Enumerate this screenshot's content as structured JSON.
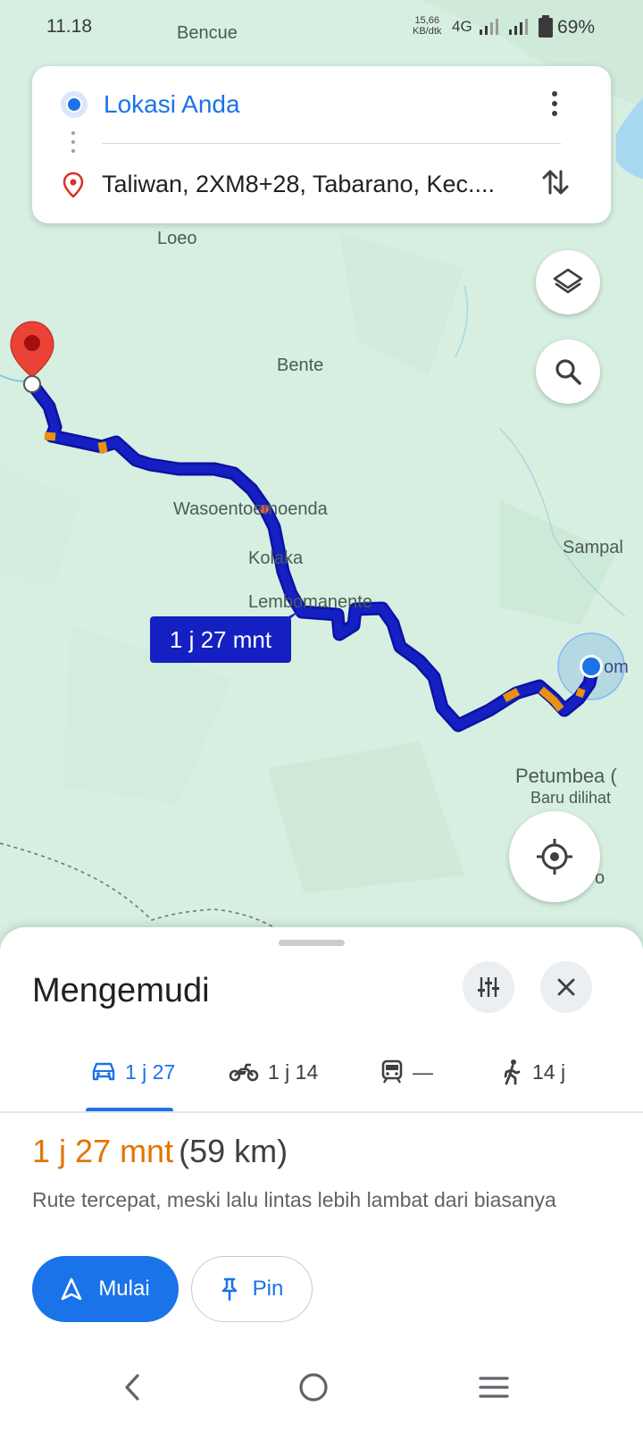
{
  "status_bar": {
    "time": "11.18",
    "speed_value": "15,66",
    "speed_unit": "KB/dtk",
    "network": "4G",
    "battery": "69%"
  },
  "map": {
    "labels": {
      "bencue": "Bencue",
      "loeo": "Loeo",
      "bente": "Bente",
      "wasoento": "Wasoentoemoenda",
      "kolaka": "Kolaka",
      "lembomanente": "Lembomanente",
      "sampal": "Sampal",
      "petumbea": "Petumbea (",
      "baru_dilihat": "Baru dilihat",
      "edge_o": "o",
      "edge_om": "om"
    },
    "route_eta": "1 j 27 mnt",
    "route_color": "#1520c2",
    "traffic_color": "#e8930f"
  },
  "directions": {
    "origin": "Lokasi Anda",
    "destination": "Taliwan, 2XM8+28, Tabarano, Kec...."
  },
  "icons": {
    "layers": "layers-icon",
    "search": "search-icon",
    "locate": "my-location-icon",
    "more": "more-vert-icon",
    "swap": "swap-icon"
  },
  "sheet": {
    "title": "Mengemudi",
    "tabs": [
      {
        "mode": "car",
        "label": "1 j 27"
      },
      {
        "mode": "motorcycle",
        "label": "1 j 14"
      },
      {
        "mode": "transit",
        "label": "—"
      },
      {
        "mode": "walk",
        "label": "14 j"
      }
    ],
    "eta_time": "1 j 27 mnt",
    "eta_distance": "(59 km)",
    "description": "Rute tercepat, meski lalu lintas lebih lambat dari biasanya",
    "start_label": "Mulai",
    "pin_label": "Pin"
  },
  "colors": {
    "accent": "#1a73e8",
    "eta_orange": "#e37400",
    "pin_red": "#d93025"
  }
}
